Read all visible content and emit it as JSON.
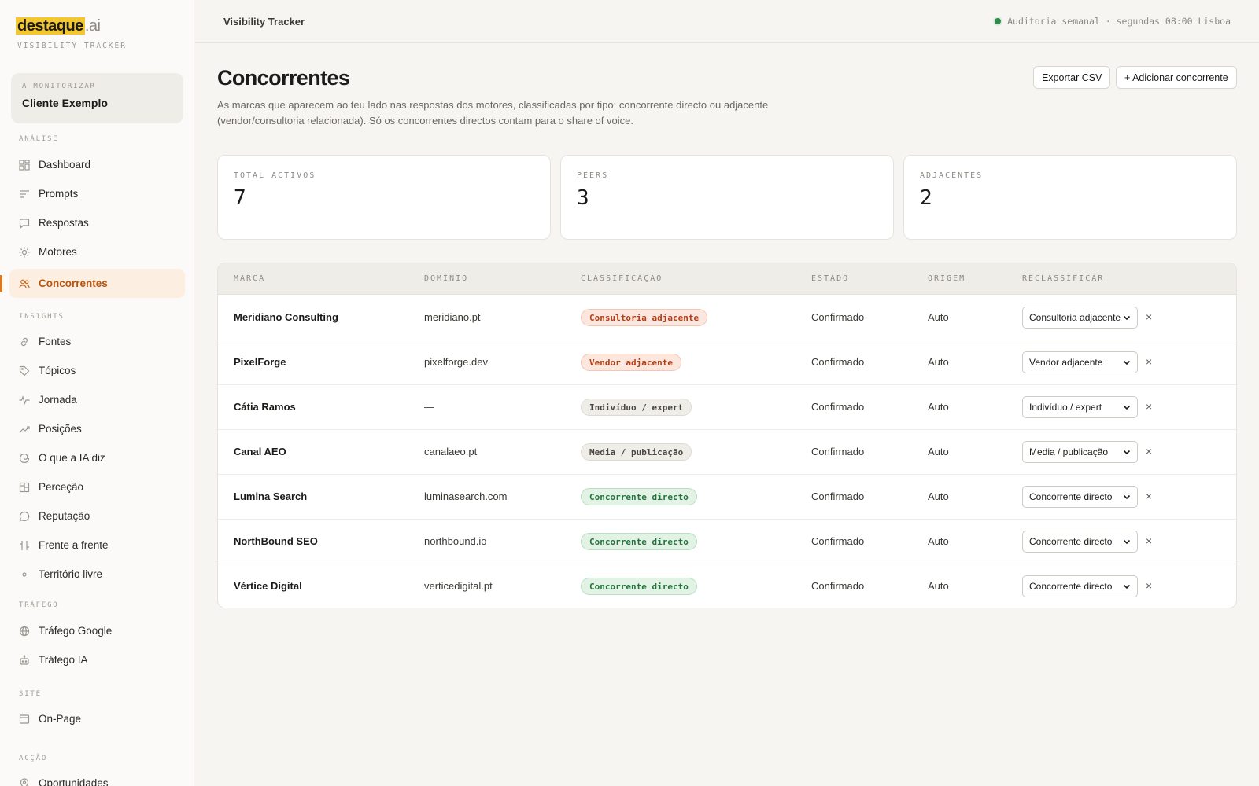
{
  "brand": {
    "logo_main": "destaque",
    "logo_tld": ".ai",
    "subtitle": "VISIBILITY TRACKER"
  },
  "client": {
    "label": "A MONITORIZAR",
    "name": "Cliente Exemplo"
  },
  "sidebar": {
    "sections": [
      {
        "label": "ANÁLISE"
      },
      {
        "label": "INSIGHTS"
      },
      {
        "label": "TRÁFEGO"
      },
      {
        "label": "SITE"
      },
      {
        "label": "ACÇÃO"
      }
    ],
    "items": [
      {
        "label": "Dashboard",
        "icon": "grid-icon"
      },
      {
        "label": "Prompts",
        "icon": "lines-icon"
      },
      {
        "label": "Respostas",
        "icon": "chat-icon"
      },
      {
        "label": "Motores",
        "icon": "sun-icon"
      },
      {
        "label": "Concorrentes",
        "icon": "users-icon",
        "active": true
      },
      {
        "label": "Fontes",
        "icon": "link-icon"
      },
      {
        "label": "Tópicos",
        "icon": "tag-icon"
      },
      {
        "label": "Jornada",
        "icon": "pulse-icon"
      },
      {
        "label": "Posições",
        "icon": "trend-icon"
      },
      {
        "label": "O que a IA diz",
        "icon": "spiral-icon"
      },
      {
        "label": "Perceção",
        "icon": "panel-icon"
      },
      {
        "label": "Reputação",
        "icon": "bubble-icon"
      },
      {
        "label": "Frente a frente",
        "icon": "versus-icon"
      },
      {
        "label": "Território livre",
        "icon": "dot-icon"
      },
      {
        "label": "Tráfego Google",
        "icon": "globe-icon"
      },
      {
        "label": "Tráfego IA",
        "icon": "robot-icon"
      },
      {
        "label": "On-Page",
        "icon": "window-icon"
      },
      {
        "label": "Oportunidades",
        "icon": "pin-icon"
      }
    ]
  },
  "topbar": {
    "title": "Visibility Tracker",
    "audit": "Auditoria semanal · segundas 08:00 Lisboa",
    "status_color": "#2f8a4c"
  },
  "page": {
    "title": "Concorrentes",
    "description": "As marcas que aparecem ao teu lado nas respostas dos motores, classificadas por tipo: concorrente directo ou adjacente (vendor/consultoria relacionada). Só os concorrentes directos contam para o share of voice.",
    "export_label": "Exportar CSV",
    "add_label": "+ Adicionar concorrente"
  },
  "stats": [
    {
      "label": "TOTAL ACTIVOS",
      "value": "7"
    },
    {
      "label": "PEERS",
      "value": "3"
    },
    {
      "label": "ADJACENTES",
      "value": "2"
    }
  ],
  "table": {
    "headers": [
      "MARCA",
      "DOMÍNIO",
      "CLASSIFICAÇÃO",
      "ESTADO",
      "ORIGEM",
      "RECLASSIFICAR"
    ],
    "rows": [
      {
        "brand": "Meridiano Consulting",
        "domain": "meridiano.pt",
        "classification": "Consultoria adjacente",
        "kind": "adj",
        "state": "Confirmado",
        "origin": "Auto",
        "reclassify": "Consultoria adjacente"
      },
      {
        "brand": "PixelForge",
        "domain": "pixelforge.dev",
        "classification": "Vendor adjacente",
        "kind": "adj",
        "state": "Confirmado",
        "origin": "Auto",
        "reclassify": "Vendor adjacente"
      },
      {
        "brand": "Cátia Ramos",
        "domain": "—",
        "classification": "Indivíduo / expert",
        "kind": "neu",
        "state": "Confirmado",
        "origin": "Auto",
        "reclassify": "Indivíduo / expert"
      },
      {
        "brand": "Canal AEO",
        "domain": "canalaeo.pt",
        "classification": "Media / publicação",
        "kind": "neu",
        "state": "Confirmado",
        "origin": "Auto",
        "reclassify": "Media / publicação"
      },
      {
        "brand": "Lumina Search",
        "domain": "luminasearch.com",
        "classification": "Concorrente directo",
        "kind": "dir",
        "state": "Confirmado",
        "origin": "Auto",
        "reclassify": "Concorrente directo"
      },
      {
        "brand": "NorthBound SEO",
        "domain": "northbound.io",
        "classification": "Concorrente directo",
        "kind": "dir",
        "state": "Confirmado",
        "origin": "Auto",
        "reclassify": "Concorrente directo"
      },
      {
        "brand": "Vértice Digital",
        "domain": "verticedigital.pt",
        "classification": "Concorrente directo",
        "kind": "dir",
        "state": "Confirmado",
        "origin": "Auto",
        "reclassify": "Concorrente directo"
      }
    ],
    "remove_glyph": "×"
  }
}
